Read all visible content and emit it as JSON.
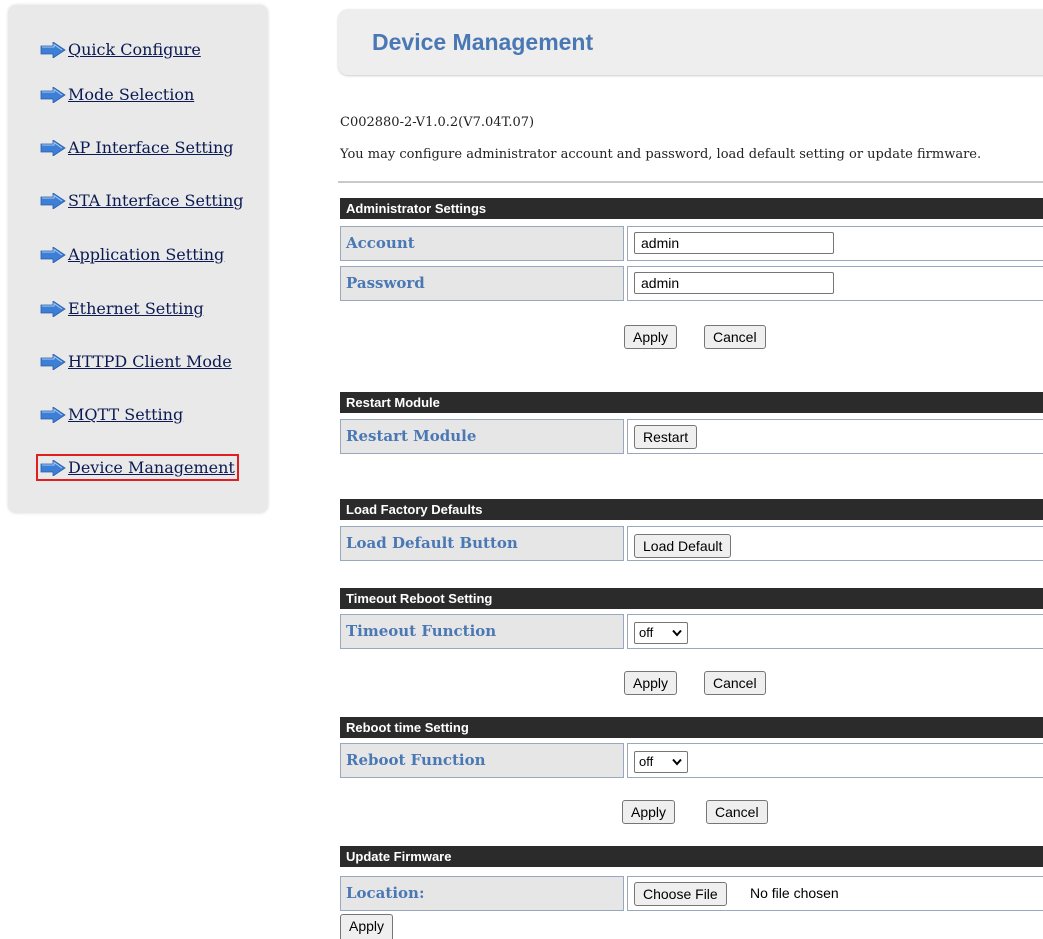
{
  "sidebar": {
    "items": [
      {
        "label": "Quick Configure"
      },
      {
        "label": "Mode Selection"
      },
      {
        "label": "AP Interface Setting"
      },
      {
        "label": "STA Interface Setting"
      },
      {
        "label": "Application Setting"
      },
      {
        "label": "Ethernet Setting"
      },
      {
        "label": "HTTPD Client Mode"
      },
      {
        "label": "MQTT Setting"
      },
      {
        "label": "Device Management",
        "active": true
      }
    ],
    "icon": "arrow-right-icon",
    "active_outline_color": "#e02020"
  },
  "header": {
    "title": "Device Management"
  },
  "version": "C002880-2-V1.0.2(V7.04T.07)",
  "description": "You may configure administrator account and password, load default setting or update firmware.",
  "admin": {
    "heading": "Administrator Settings",
    "account_label": "Account",
    "account_value": "admin",
    "password_label": "Password",
    "password_value": "admin",
    "apply": "Apply",
    "cancel": "Cancel"
  },
  "restart": {
    "heading": "Restart Module",
    "label": "Restart Module",
    "button": "Restart"
  },
  "factory": {
    "heading": "Load Factory Defaults",
    "label": "Load Default Button",
    "button": "Load Default"
  },
  "timeout": {
    "heading": "Timeout Reboot Setting",
    "label": "Timeout Function",
    "value": "off",
    "apply": "Apply",
    "cancel": "Cancel"
  },
  "reboot": {
    "heading": "Reboot time Setting",
    "label": "Reboot Function",
    "value": "off",
    "apply": "Apply",
    "cancel": "Cancel"
  },
  "firmware": {
    "heading": "Update Firmware",
    "label": "Location:",
    "choose": "Choose File",
    "nofile": "No file chosen",
    "apply": "Apply"
  },
  "colors": {
    "label_text": "#4a78b4",
    "section_header_bg": "#2b2b2b",
    "label_cell_bg": "#e6e6e6",
    "sidebar_bg": "#e9e9e9",
    "nav_link": "#0b1a52"
  }
}
